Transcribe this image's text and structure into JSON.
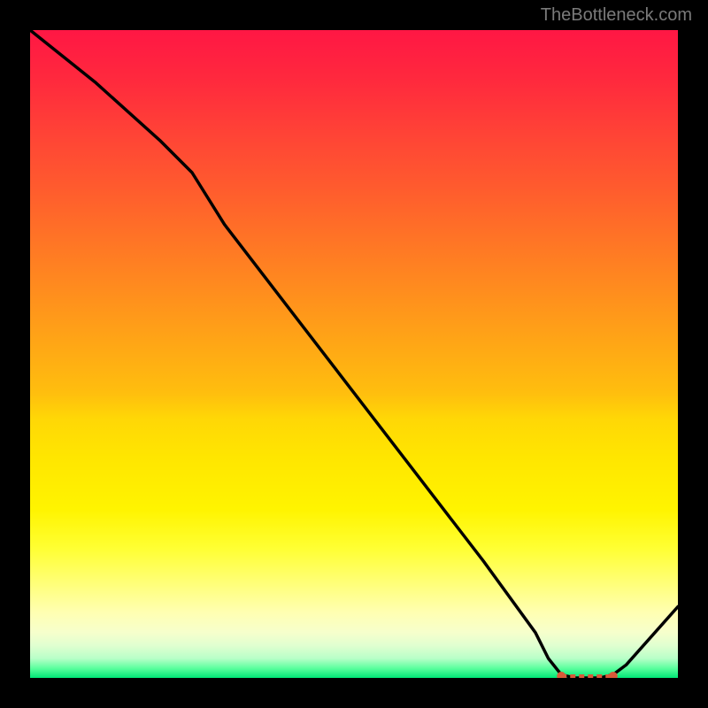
{
  "attribution": "TheBottleneck.com",
  "chart_data": {
    "type": "line",
    "title": "",
    "xlabel": "",
    "ylabel": "",
    "xlim": [
      0,
      100
    ],
    "ylim": [
      0,
      100
    ],
    "series": [
      {
        "name": "curve",
        "x": [
          0,
          10,
          20,
          25,
          30,
          40,
          50,
          60,
          70,
          78,
          80,
          82,
          84,
          86,
          88,
          90,
          92,
          100
        ],
        "values": [
          100,
          92,
          83,
          78,
          70,
          57,
          44,
          31,
          18,
          7,
          3,
          0.5,
          0,
          0,
          0,
          0.5,
          2,
          11
        ]
      }
    ],
    "flat_band": {
      "x_start": 82,
      "x_end": 90,
      "y": 0
    },
    "gradient_stops": [
      {
        "pos": 0,
        "color": "#ff1744"
      },
      {
        "pos": 50,
        "color": "#ffa516"
      },
      {
        "pos": 80,
        "color": "#ffff33"
      },
      {
        "pos": 100,
        "color": "#00e676"
      }
    ]
  }
}
